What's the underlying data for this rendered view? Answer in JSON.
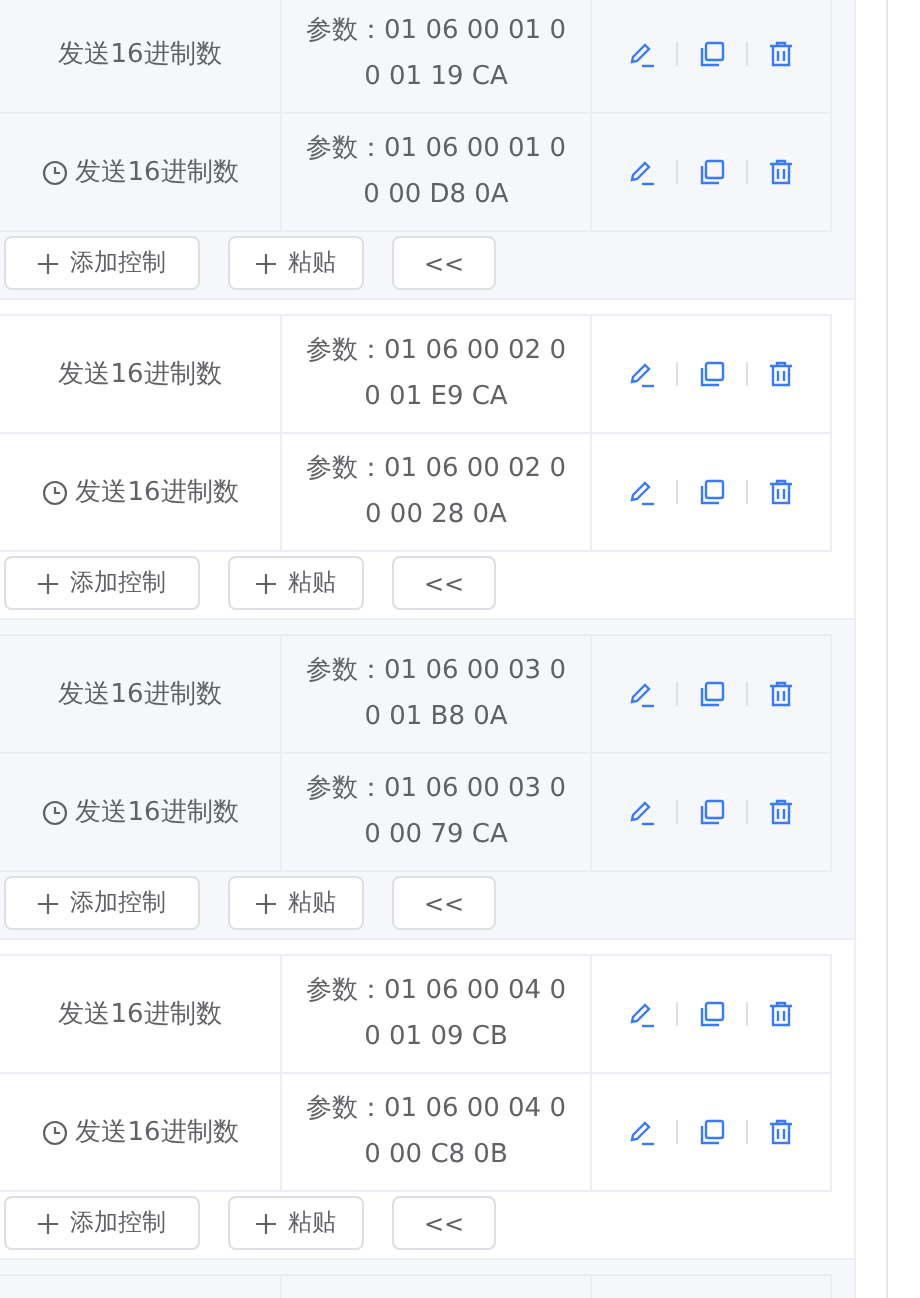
{
  "groups": [
    {
      "rows": [
        {
          "timed": false,
          "command": "发送16进制数",
          "params": "参数：01 06 00 01 00 01 19 CA"
        },
        {
          "timed": true,
          "command": "发送16进制数",
          "params": "参数：01 06 00 01 00 00 D8 0A"
        }
      ],
      "buttons": [
        "添加控制",
        "粘贴",
        "<<"
      ]
    },
    {
      "rows": [
        {
          "timed": false,
          "command": "发送16进制数",
          "params": "参数：01 06 00 02 00 01 E9 CA"
        },
        {
          "timed": true,
          "command": "发送16进制数",
          "params": "参数：01 06 00 02 00 00 28 0A"
        }
      ],
      "buttons": [
        "添加控制",
        "粘贴",
        "<<"
      ]
    },
    {
      "rows": [
        {
          "timed": false,
          "command": "发送16进制数",
          "params": "参数：01 06 00 03 00 01 B8 0A"
        },
        {
          "timed": true,
          "command": "发送16进制数",
          "params": "参数：01 06 00 03 00 00 79 CA"
        }
      ],
      "buttons": [
        "添加控制",
        "粘贴",
        "<<"
      ]
    },
    {
      "rows": [
        {
          "timed": false,
          "command": "发送16进制数",
          "params": "参数：01 06 00 04 00 01 09 CB"
        },
        {
          "timed": true,
          "command": "发送16进制数",
          "params": "参数：01 06 00 04 00 00 C8 0B"
        }
      ],
      "buttons": [
        "添加控制",
        "粘贴",
        "<<"
      ]
    }
  ]
}
